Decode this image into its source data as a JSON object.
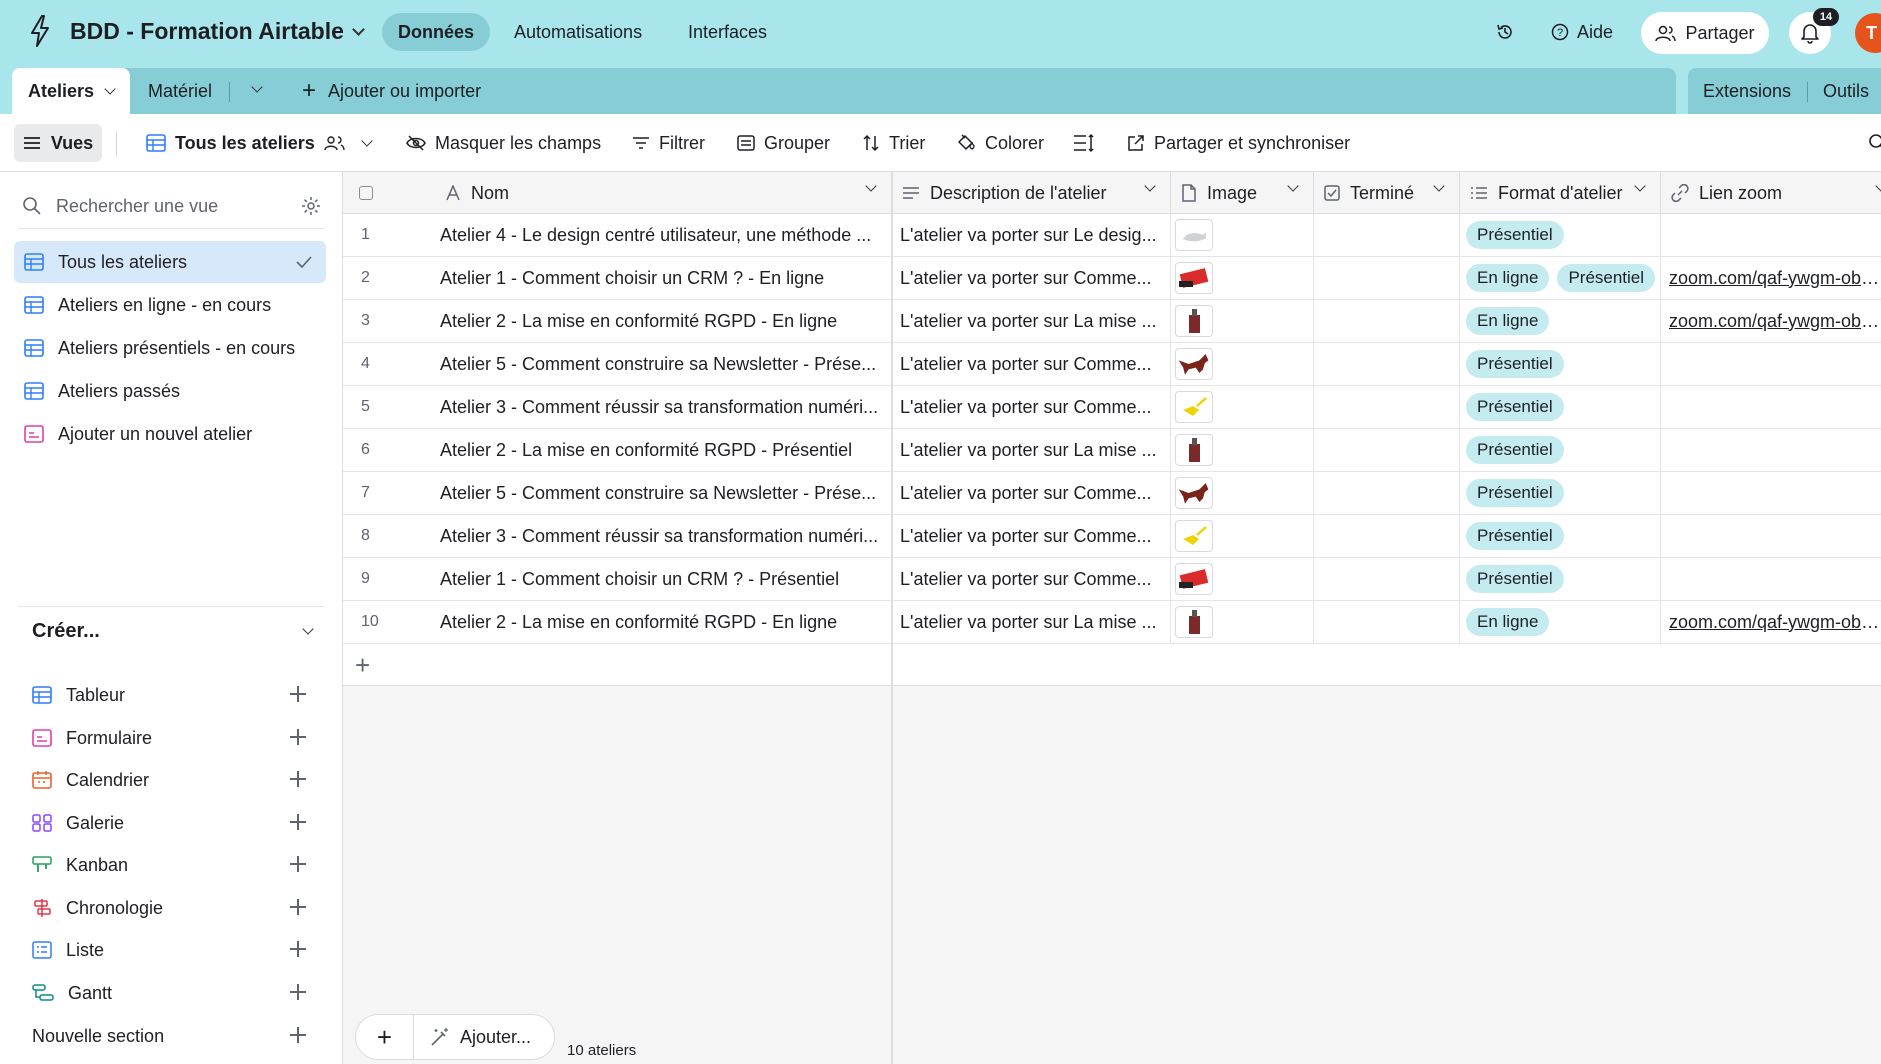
{
  "topbar": {
    "base_title": "BDD - Formation Airtable",
    "tabs": [
      {
        "label": "Données",
        "active": true
      },
      {
        "label": "Automatisations",
        "active": false
      },
      {
        "label": "Interfaces",
        "active": false
      }
    ],
    "help_label": "Aide",
    "share_label": "Partager",
    "notification_count": "14",
    "avatar_initial": "T",
    "accent_color": "#a8e6ec"
  },
  "tablebar": {
    "tables": [
      {
        "label": "Ateliers",
        "active": true
      },
      {
        "label": "Matériel",
        "active": false
      }
    ],
    "add_label": "Ajouter ou importer",
    "extensions_label": "Extensions",
    "tools_label": "Outils"
  },
  "viewbar": {
    "views_label": "Vues",
    "current_view": "Tous les ateliers",
    "hide_fields": "Masquer les champs",
    "filter": "Filtrer",
    "group": "Grouper",
    "sort": "Trier",
    "color": "Colorer",
    "share_sync": "Partager et synchroniser"
  },
  "sidebar": {
    "search_placeholder": "Rechercher une vue",
    "views": [
      {
        "label": "Tous les ateliers",
        "icon": "grid-icon",
        "active": true
      },
      {
        "label": "Ateliers en ligne - en cours",
        "icon": "grid-icon",
        "active": false
      },
      {
        "label": "Ateliers présentiels - en cours",
        "icon": "grid-icon",
        "active": false
      },
      {
        "label": "Ateliers passés",
        "icon": "grid-icon",
        "active": false
      },
      {
        "label": "Ajouter un nouvel atelier",
        "icon": "form-icon",
        "active": false
      }
    ],
    "create_label": "Créer...",
    "create_items": [
      {
        "label": "Tableur",
        "icon": "grid-icon"
      },
      {
        "label": "Formulaire",
        "icon": "form-icon"
      },
      {
        "label": "Calendrier",
        "icon": "calendar-icon"
      },
      {
        "label": "Galerie",
        "icon": "gallery-icon"
      },
      {
        "label": "Kanban",
        "icon": "kanban-icon"
      },
      {
        "label": "Chronologie",
        "icon": "timeline-icon"
      },
      {
        "label": "Liste",
        "icon": "list-icon"
      },
      {
        "label": "Gantt",
        "icon": "gantt-icon"
      }
    ],
    "new_section_label": "Nouvelle section"
  },
  "grid": {
    "columns": [
      "Nom",
      "Description de l'atelier",
      "Image",
      "Terminé",
      "Format d'atelier",
      "Lien zoom"
    ],
    "rows": [
      {
        "n": "1",
        "name": "Atelier 4 - Le design centré utilisateur, une méthode ...",
        "desc": "L'atelier va porter sur Le desig...",
        "image": "cat",
        "formats": [
          "Présentiel"
        ],
        "link": ""
      },
      {
        "n": "2",
        "name": "Atelier 1 - Comment choisir un CRM ? - En ligne",
        "desc": "L'atelier va porter sur Comme...",
        "image": "red",
        "formats": [
          "En ligne",
          "Présentiel"
        ],
        "link": "zoom.com/qaf-ywgm-obf..."
      },
      {
        "n": "3",
        "name": "Atelier 2 - La mise en conformité RGPD - En ligne",
        "desc": "L'atelier va porter sur La mise ...",
        "image": "bottle",
        "formats": [
          "En ligne"
        ],
        "link": "zoom.com/qaf-ywgm-obf..."
      },
      {
        "n": "4",
        "name": "Atelier 5 - Comment construire sa Newsletter - Prése...",
        "desc": "L'atelier va porter sur Comme...",
        "image": "dog",
        "formats": [
          "Présentiel"
        ],
        "link": ""
      },
      {
        "n": "5",
        "name": "Atelier 3 - Comment réussir sa transformation numéri...",
        "desc": "L'atelier va porter sur Comme...",
        "image": "yellow",
        "formats": [
          "Présentiel"
        ],
        "link": ""
      },
      {
        "n": "6",
        "name": "Atelier 2 - La mise en conformité RGPD - Présentiel",
        "desc": "L'atelier va porter sur La mise ...",
        "image": "bottle",
        "formats": [
          "Présentiel"
        ],
        "link": ""
      },
      {
        "n": "7",
        "name": "Atelier 5 - Comment construire sa Newsletter - Prése...",
        "desc": "L'atelier va porter sur Comme...",
        "image": "dog",
        "formats": [
          "Présentiel"
        ],
        "link": ""
      },
      {
        "n": "8",
        "name": "Atelier 3 - Comment réussir sa transformation numéri...",
        "desc": "L'atelier va porter sur Comme...",
        "image": "yellow",
        "formats": [
          "Présentiel"
        ],
        "link": ""
      },
      {
        "n": "9",
        "name": "Atelier 1 - Comment choisir un CRM ? - Présentiel",
        "desc": "L'atelier va porter sur Comme...",
        "image": "red",
        "formats": [
          "Présentiel"
        ],
        "link": ""
      },
      {
        "n": "10",
        "name": "Atelier 2 - La mise en conformité RGPD - En ligne",
        "desc": "L'atelier va porter sur La mise ...",
        "image": "bottle",
        "formats": [
          "En ligne"
        ],
        "link": "zoom.com/qaf-ywgm-obf..."
      }
    ],
    "footer_add_label": "Ajouter...",
    "record_count": "10 ateliers"
  }
}
